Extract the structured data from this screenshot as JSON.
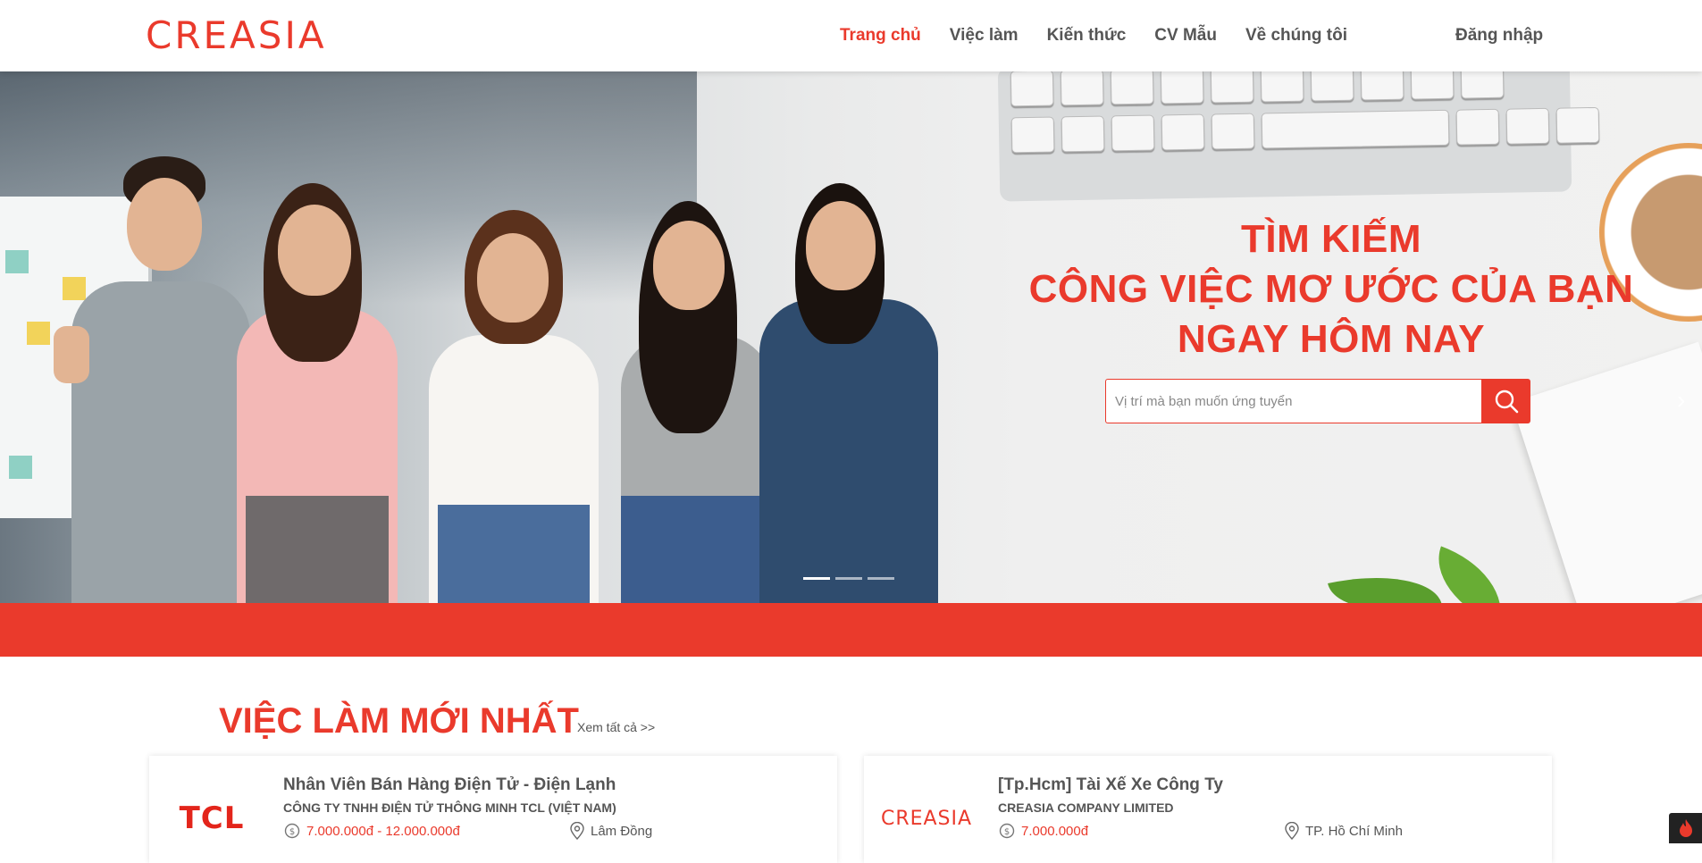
{
  "header": {
    "logo": "CREASIA",
    "nav": [
      {
        "label": "Trang chủ",
        "active": true
      },
      {
        "label": "Việc làm",
        "active": false
      },
      {
        "label": "Kiến thức",
        "active": false
      },
      {
        "label": "CV Mẫu",
        "active": false
      },
      {
        "label": "Về chúng tôi",
        "active": false
      }
    ],
    "login": "Đăng nhập"
  },
  "hero": {
    "title_line1": "TÌM KIẾM",
    "title_line2": "CÔNG VIỆC MƠ ƯỚC CỦA BẠN",
    "title_line3": "NGAY HÔM NAY",
    "search_placeholder": "Vị trí mà bạn muốn ứng tuyển",
    "slides": 3,
    "active_slide": 1
  },
  "latest_jobs": {
    "title": "VIỆC LÀM MỚI NHẤT",
    "see_all": "Xem tất cả >>",
    "jobs": [
      {
        "logo": "TCL",
        "title": "Nhân Viên Bán Hàng Điện Tử - Điện Lạnh",
        "company": "CÔNG TY TNHH ĐIỆN TỬ THÔNG MINH TCL (VIỆT NAM)",
        "salary": "7.000.000đ - 12.000.000đ",
        "location": "Lâm Đồng"
      },
      {
        "logo": "CREASIA",
        "title": "[Tp.Hcm] Tài Xế Xe Công Ty",
        "company": "CREASIA COMPANY LIMITED",
        "salary": "7.000.000đ",
        "location": "TP. Hồ Chí Minh"
      }
    ]
  },
  "colors": {
    "brand": "#ea3a2c",
    "nav_text": "#555555"
  },
  "icons": [
    "search-icon",
    "money-icon",
    "location-pin-icon",
    "chevron-right-icon",
    "fire-icon"
  ]
}
